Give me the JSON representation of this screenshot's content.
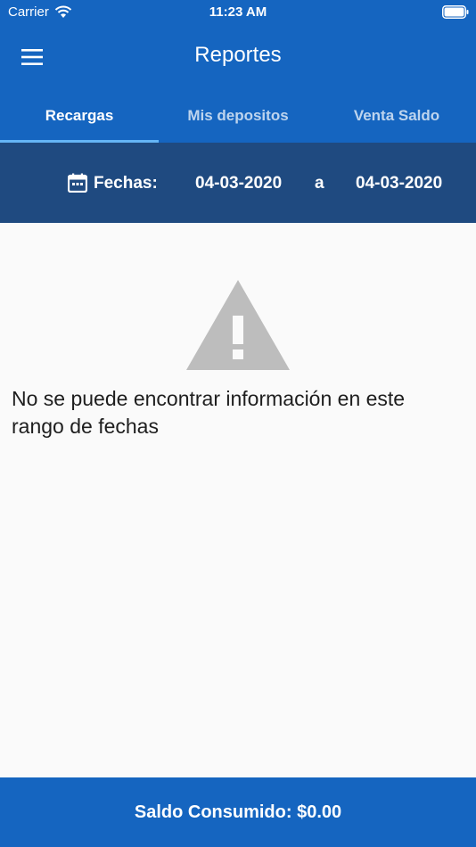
{
  "status_bar": {
    "carrier": "Carrier",
    "time": "11:23 AM"
  },
  "app_bar": {
    "title": "Reportes"
  },
  "tabs": [
    {
      "label": "Recargas",
      "active": true
    },
    {
      "label": "Mis depositos",
      "active": false
    },
    {
      "label": "Venta Saldo",
      "active": false
    }
  ],
  "filter": {
    "label": "Fechas:",
    "date_from": "04-03-2020",
    "separator": "a",
    "date_to": "04-03-2020"
  },
  "empty_state": {
    "message": "No se puede encontrar información en este rango de fechas"
  },
  "footer": {
    "balance_text": "Saldo Consumido: $0.00"
  },
  "colors": {
    "primary": "#1565c0",
    "filter_bar": "#1f4a80",
    "tab_indicator": "#64b5f6",
    "warning_icon": "#bdbdbd"
  }
}
